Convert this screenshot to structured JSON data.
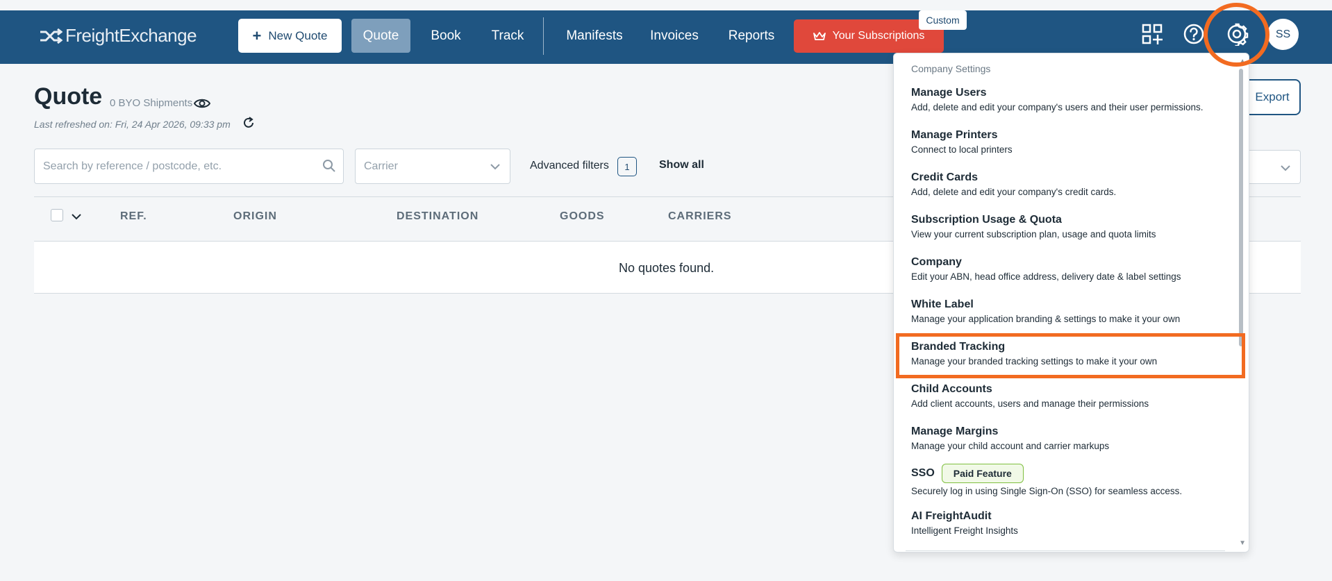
{
  "brand": {
    "name": "FreightExchange"
  },
  "nav": {
    "new_quote": "New Quote",
    "quote": "Quote",
    "book": "Book",
    "track": "Track",
    "manifests": "Manifests",
    "invoices": "Invoices",
    "reports": "Reports",
    "subscriptions": "Your Subscriptions",
    "custom_badge": "Custom",
    "avatar_initials": "SS"
  },
  "page": {
    "title": "Quote",
    "byo_shipments": "0 BYO Shipments",
    "last_refreshed": "Last refreshed on: Fri, 24 Apr 2026, 09:33 pm",
    "export_label": "Export"
  },
  "filters": {
    "search_placeholder": "Search by reference / postcode, etc.",
    "carrier_placeholder": "Carrier",
    "advanced_filters": "Advanced filters",
    "advanced_count": "1",
    "show_all": "Show all"
  },
  "table": {
    "columns": [
      "REF.",
      "ORIGIN",
      "DESTINATION",
      "GOODS",
      "CARRIERS"
    ],
    "empty_message": "No quotes found."
  },
  "settings_menu": {
    "section": "Company Settings",
    "items": [
      {
        "title": "Manage Users",
        "desc": "Add, delete and edit your company's users and their user permissions."
      },
      {
        "title": "Manage Printers",
        "desc": "Connect to local printers"
      },
      {
        "title": "Credit Cards",
        "desc": "Add, delete and edit your company's credit cards."
      },
      {
        "title": "Subscription Usage & Quota",
        "desc": "View your current subscription plan, usage and quota limits"
      },
      {
        "title": "Company",
        "desc": "Edit your ABN, head office address, delivery date & label settings"
      },
      {
        "title": "White Label",
        "desc": "Manage your application branding & settings to make it your own"
      },
      {
        "title": "Branded Tracking",
        "desc": "Manage your branded tracking settings to make it your own"
      },
      {
        "title": "Child Accounts",
        "desc": "Add client accounts, users and manage their permissions"
      },
      {
        "title": "Manage Margins",
        "desc": "Manage your child account and carrier markups"
      },
      {
        "title": "SSO",
        "desc": "Securely log in using Single Sign-On (SSO) for seamless access.",
        "badge": "Paid Feature"
      },
      {
        "title": "AI FreightAudit",
        "desc": "Intelligent Freight Insights"
      }
    ]
  },
  "colors": {
    "navbar": "#1f5582",
    "subscriptions": "#e0483b",
    "highlight": "#f26b21",
    "paid_badge_border": "#7fbf3f"
  },
  "icons": [
    "apps-add-icon",
    "help-icon",
    "gear-icon",
    "search-icon",
    "chevron-down-icon",
    "eye-icon",
    "refresh-icon",
    "crown-icon",
    "plus-icon"
  ]
}
